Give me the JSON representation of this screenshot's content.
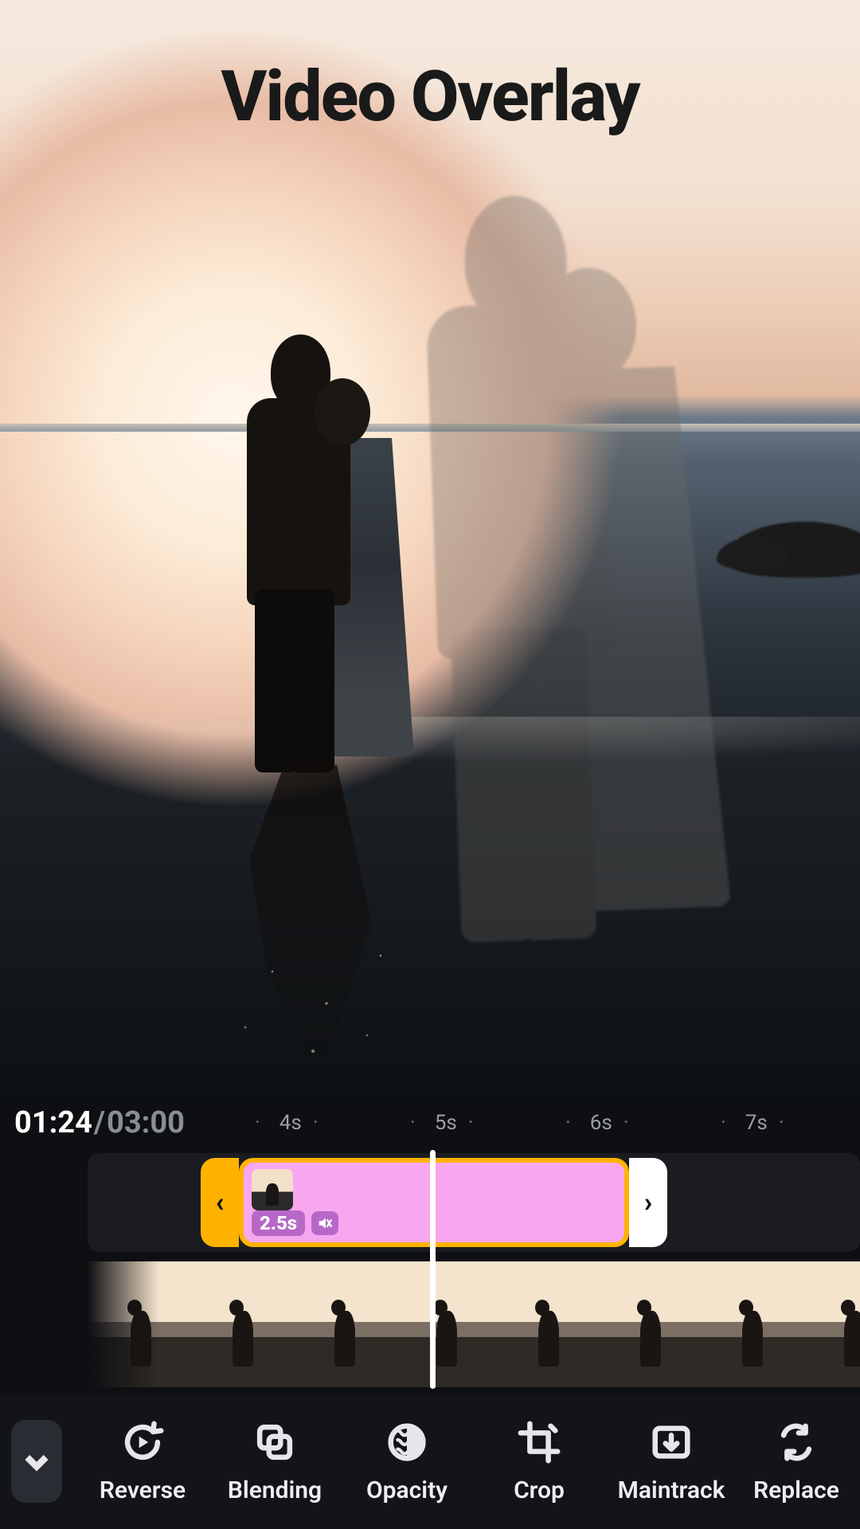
{
  "header": {
    "title": "Video Overlay"
  },
  "time": {
    "current": "01:24",
    "total": "03:00",
    "separator": "/"
  },
  "ruler": {
    "ticks": [
      "4s",
      "5s",
      "6s",
      "7s"
    ]
  },
  "overlay_clip": {
    "duration_badge": "2.5s"
  },
  "clip_handles": {
    "left_glyph": "‹",
    "right_glyph": "›"
  },
  "toolbar": {
    "items": [
      {
        "key": "reverse",
        "label": "Reverse"
      },
      {
        "key": "blending",
        "label": "Blending"
      },
      {
        "key": "opacity",
        "label": "Opacity"
      },
      {
        "key": "crop",
        "label": "Crop"
      },
      {
        "key": "maintrack",
        "label": "Maintrack"
      },
      {
        "key": "replace",
        "label": "Replace"
      }
    ]
  }
}
